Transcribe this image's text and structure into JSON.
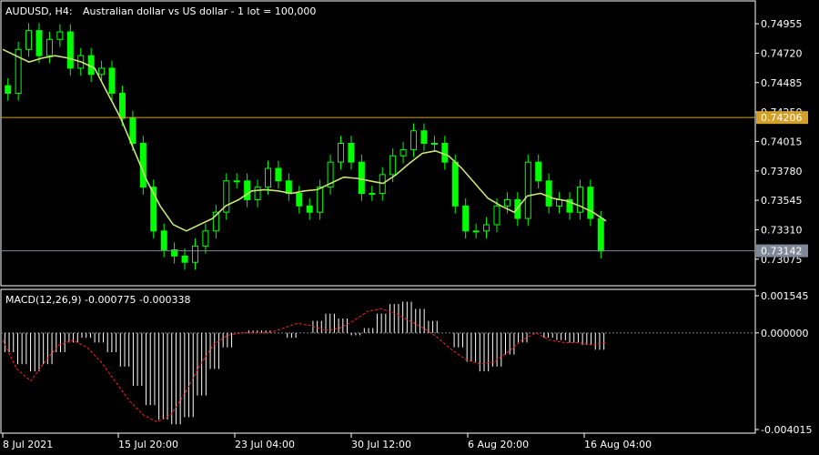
{
  "header": {
    "symbol": "AUDUSD, H4:",
    "description": "Australian dollar vs US dollar - 1 lot = 100,000"
  },
  "indicator": {
    "label": "MACD(12,26,9) -0.000775 -0.000338"
  },
  "colors": {
    "background": "#000000",
    "bull_candle": "#00ff00",
    "moving_average": "#c8e675",
    "horizontal_line": "#d4a028",
    "bid_line": "#7f8896",
    "macd_hist": "#ffffff",
    "macd_signal": "#ff2020",
    "grid_border": "#ffffff"
  },
  "price_axis": {
    "ticks": [
      "0.74955",
      "0.74720",
      "0.74485",
      "0.74250",
      "0.74015",
      "0.73780",
      "0.73545",
      "0.73310",
      "0.73075"
    ],
    "range": [
      0.7287,
      0.7513
    ],
    "level_label": "0.74206",
    "bid_label": "0.73142"
  },
  "macd_axis": {
    "ticks": [
      "0.001545",
      "0.000000",
      "-0.004015"
    ],
    "range": [
      -0.004015,
      0.001545
    ]
  },
  "time_axis": {
    "labels": [
      "8 Jul 2021",
      "15 Jul 20:00",
      "23 Jul 04:00",
      "30 Jul 12:00",
      "6 Aug 20:00",
      "16 Aug 04:00"
    ]
  },
  "chart_data": {
    "type": "line",
    "title": "AUDUSD, H4:",
    "series": [
      {
        "name": "AUDUSD",
        "y": [
          0.744,
          0.7475,
          0.749,
          0.747,
          0.7483,
          0.7489,
          0.746,
          0.747,
          0.7455,
          0.746,
          0.744,
          0.742,
          0.74,
          0.7365,
          0.733,
          0.7315,
          0.731,
          0.7305,
          0.7318,
          0.733,
          0.7345,
          0.737,
          0.737,
          0.7355,
          0.7365,
          0.738,
          0.737,
          0.736,
          0.735,
          0.7345,
          0.7365,
          0.7385,
          0.74,
          0.7385,
          0.736,
          0.736,
          0.7375,
          0.739,
          0.7395,
          0.741,
          0.74,
          0.74,
          0.7385,
          0.735,
          0.733,
          0.733,
          0.7335,
          0.735,
          0.7355,
          0.734,
          0.7385,
          0.737,
          0.735,
          0.7355,
          0.7345,
          0.7365,
          0.734,
          0.7314
        ]
      },
      {
        "name": "",
        "y": [
          0.7475,
          0.747,
          0.7465,
          0.7468,
          0.747,
          0.7468,
          0.7465,
          0.746,
          0.744,
          0.742,
          0.7395,
          0.737,
          0.735,
          0.7335,
          0.733,
          0.7335,
          0.734,
          0.735,
          0.7355,
          0.7362,
          0.7363,
          0.7362,
          0.736,
          0.7362,
          0.7363,
          0.7368,
          0.7373,
          0.7372,
          0.737,
          0.7368,
          0.7375,
          0.7384,
          0.7392,
          0.7394,
          0.739,
          0.738,
          0.7368,
          0.7356,
          0.735,
          0.7345,
          0.7358,
          0.736,
          0.7356,
          0.7354,
          0.735,
          0.7345,
          0.7338
        ]
      }
    ],
    "horizontal_level": 0.74206,
    "last_price": 0.73142
  },
  "macd_data": {
    "histogram": [
      -0.0008,
      -0.0013,
      -0.0016,
      -0.0013,
      -0.0008,
      -0.0004,
      -0.0002,
      -0.0004,
      -0.0008,
      -0.0014,
      -0.0022,
      -0.003,
      -0.0036,
      -0.0038,
      -0.0035,
      -0.0026,
      -0.0015,
      -0.0006,
      0.0,
      0.0001,
      0.0001,
      0.0,
      -0.0002,
      0.0,
      0.0005,
      0.0008,
      0.0006,
      -0.0001,
      0.0002,
      0.0008,
      0.0012,
      0.0013,
      0.001,
      0.0005,
      0.0,
      -0.0006,
      -0.0012,
      -0.0016,
      -0.0014,
      -0.0009,
      -0.0004,
      0.0,
      -0.0002,
      -0.0003,
      -0.0004,
      -0.0005,
      -0.0007
    ],
    "signal": [
      -0.0003,
      -0.0015,
      -0.002,
      -0.0012,
      -0.0005,
      -0.0003,
      -0.0006,
      -0.0012,
      -0.002,
      -0.0028,
      -0.0034,
      -0.0037,
      -0.0034,
      -0.0025,
      -0.0014,
      -0.0005,
      -0.0001,
      0.0,
      0.0,
      0.0,
      0.0002,
      0.0004,
      0.0003,
      0.0001,
      0.0002,
      0.0005,
      0.0009,
      0.001,
      0.0008,
      0.0005,
      0.0002,
      -0.0002,
      -0.0007,
      -0.0011,
      -0.0013,
      -0.0012,
      -0.0008,
      -0.0003,
      0.0,
      -0.0003,
      -0.0004,
      -0.0004,
      -0.0005,
      -0.0004
    ]
  }
}
